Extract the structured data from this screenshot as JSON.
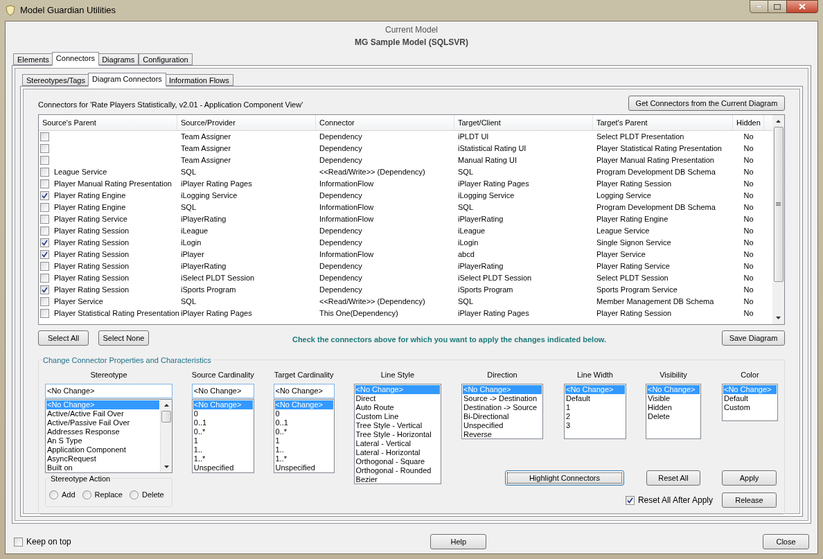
{
  "window": {
    "title": "Model Guardian Utilities"
  },
  "current_model": {
    "label": "Current Model",
    "name": "MG Sample Model (SQLSVR)"
  },
  "tabs": [
    {
      "label": "Elements",
      "selected": false
    },
    {
      "label": "Connectors",
      "selected": true
    },
    {
      "label": "Diagrams",
      "selected": false
    },
    {
      "label": "Configuration",
      "selected": false
    }
  ],
  "subtabs": [
    {
      "label": "Stereotypes/Tags",
      "selected": false
    },
    {
      "label": "Diagram Connectors",
      "selected": true
    },
    {
      "label": "Information Flows",
      "selected": false
    }
  ],
  "caption": "Connectors for 'Rate Players Statistically, v2.01 - Application Component View'",
  "get_button": "Get Connectors from the Current Diagram",
  "table": {
    "columns": [
      "Source's Parent",
      "Source/Provider",
      "Connector",
      "Target/Client",
      "Target's Parent",
      "Hidden"
    ],
    "rows": [
      {
        "checked": false,
        "source": "Team Assigner",
        "connector": "Dependency",
        "target": "iPLDT UI",
        "target_parent": "Select PLDT Presentation",
        "hidden": "No"
      },
      {
        "checked": false,
        "source": "Team Assigner",
        "connector": "Dependency",
        "target": "iStatistical Rating UI",
        "target_parent": "Player Statistical Rating Presentation",
        "hidden": "No"
      },
      {
        "checked": false,
        "source": "Team Assigner",
        "connector": "Dependency",
        "target": "Manual Rating UI",
        "target_parent": "Player Manual Rating Presentation",
        "hidden": "No"
      },
      {
        "checked": false,
        "source_parent": "League Service",
        "source": "SQL",
        "connector": "<<Read/Write>> (Dependency)",
        "target": "SQL",
        "target_parent": "Program Development DB Schema",
        "hidden": "No"
      },
      {
        "checked": false,
        "source_parent": "Player Manual Rating Presentation",
        "source": "iPlayer Rating Pages",
        "connector": "InformationFlow",
        "target": "iPlayer Rating Pages",
        "target_parent": "Player Rating Session",
        "hidden": "No"
      },
      {
        "checked": true,
        "source_parent": "Player Rating Engine",
        "source": "iLogging Service",
        "connector": "Dependency",
        "target": "iLogging Service",
        "target_parent": "Logging Service",
        "hidden": "No"
      },
      {
        "checked": false,
        "source_parent": "Player Rating Engine",
        "source": "SQL",
        "connector": "InformationFlow",
        "target": "SQL",
        "target_parent": "Program Development DB Schema",
        "hidden": "No"
      },
      {
        "checked": false,
        "source_parent": "Player Rating Service",
        "source": "iPlayerRating",
        "connector": "InformationFlow",
        "target": "iPlayerRating",
        "target_parent": "Player Rating Engine",
        "hidden": "No"
      },
      {
        "checked": false,
        "source_parent": "Player Rating Session",
        "source": "iLeague",
        "connector": "Dependency",
        "target": "iLeague",
        "target_parent": "League Service",
        "hidden": "No"
      },
      {
        "checked": true,
        "source_parent": "Player Rating Session",
        "source": "iLogin",
        "connector": "Dependency",
        "target": "iLogin",
        "target_parent": "Single Signon Service",
        "hidden": "No"
      },
      {
        "checked": true,
        "source_parent": "Player Rating Session",
        "source": "iPlayer",
        "connector": "InformationFlow",
        "target": "abcd",
        "target_parent": "Player Service",
        "hidden": "No"
      },
      {
        "checked": false,
        "source_parent": "Player Rating Session",
        "source": "iPlayerRating",
        "connector": "Dependency",
        "target": "iPlayerRating",
        "target_parent": "Player Rating Service",
        "hidden": "No"
      },
      {
        "checked": false,
        "source_parent": "Player Rating Session",
        "source": "iSelect PLDT Session",
        "connector": "Dependency",
        "target": "iSelect PLDT Session",
        "target_parent": "Select PLDT Session",
        "hidden": "No"
      },
      {
        "checked": true,
        "source_parent": "Player Rating Session",
        "source": "iSports Program",
        "connector": "Dependency",
        "target": "iSports Program",
        "target_parent": "Sports Program Service",
        "hidden": "No"
      },
      {
        "checked": false,
        "source_parent": "Player Service",
        "source": "SQL",
        "connector": "<<Read/Write>> (Dependency)",
        "target": "SQL",
        "target_parent": "Member Management DB Schema",
        "hidden": "No"
      },
      {
        "checked": false,
        "source_parent": "Player Statistical Rating Presentation",
        "source": "iPlayer Rating Pages",
        "connector": "This One(Dependency)",
        "target": "iPlayer Rating Pages",
        "target_parent": "Player Rating Session",
        "hidden": "No"
      }
    ]
  },
  "select_all": "Select All",
  "select_none": "Select None",
  "instruction": "Check the connectors above for which you want to apply the changes indicated below.",
  "save_button": "Save Diagram",
  "properties": {
    "title": "Change Connector Properties and Characteristics",
    "left_lists": [
      {
        "kind": "combo",
        "label": "Stereotype",
        "value": "<No Change>",
        "scrolls": true,
        "items": [
          {
            "text": "<No Change>",
            "selected": true
          },
          {
            "text": "Active/Active Fail Over",
            "selected": false
          },
          {
            "text": "Active/Passive Fail Over",
            "selected": false
          },
          {
            "text": "Addresses Response",
            "selected": false
          },
          {
            "text": "An S Type",
            "selected": false
          },
          {
            "text": "Application Component",
            "selected": false
          },
          {
            "text": "AsyncRequest",
            "selected": false
          },
          {
            "text": "Built on",
            "selected": false
          }
        ]
      },
      {
        "kind": "combo",
        "label": "Source Cardinality",
        "value": "<No Change>",
        "scrolls": false,
        "items": [
          {
            "text": "<No Change>",
            "selected": true
          },
          {
            "text": "0",
            "selected": false
          },
          {
            "text": "0..1",
            "selected": false
          },
          {
            "text": "0..*",
            "selected": false
          },
          {
            "text": "1",
            "selected": false
          },
          {
            "text": "1..",
            "selected": false
          },
          {
            "text": "1..*",
            "selected": false
          },
          {
            "text": "Unspecified",
            "selected": false
          }
        ]
      },
      {
        "kind": "combo",
        "label": "Target Cardinality",
        "value": "<No Change>",
        "scrolls": false,
        "items": [
          {
            "text": "<No Change>",
            "selected": true
          },
          {
            "text": "0",
            "selected": false
          },
          {
            "text": "0..1",
            "selected": false
          },
          {
            "text": "0..*",
            "selected": false
          },
          {
            "text": "1",
            "selected": false
          },
          {
            "text": "1..",
            "selected": false
          },
          {
            "text": "1..*",
            "selected": false
          },
          {
            "text": "Unspecified",
            "selected": false
          }
        ]
      },
      {
        "kind": "list",
        "label": "Line Style",
        "scrolls": false,
        "items": [
          {
            "text": "<No Change>",
            "selected": true
          },
          {
            "text": "Direct",
            "selected": false
          },
          {
            "text": "Auto Route",
            "selected": false
          },
          {
            "text": "Custom Line",
            "selected": false
          },
          {
            "text": "Tree Style - Vertical",
            "selected": false
          },
          {
            "text": "Tree Style - Horizontal",
            "selected": false
          },
          {
            "text": "Lateral - Vertical",
            "selected": false
          },
          {
            "text": "Lateral - Horizontal",
            "selected": false
          },
          {
            "text": "Orthogonal - Square",
            "selected": false
          },
          {
            "text": "Orthogonal - Rounded",
            "selected": false
          },
          {
            "text": "Bezier",
            "selected": false
          }
        ]
      }
    ],
    "right_lists": [
      {
        "kind": "list",
        "label": "Direction",
        "scrolls": false,
        "items": [
          {
            "text": "<No Change>",
            "selected": true
          },
          {
            "text": "Source -> Destination",
            "selected": false
          },
          {
            "text": "Destination -> Source",
            "selected": false
          },
          {
            "text": "Bi-Directional",
            "selected": false
          },
          {
            "text": "Unspecified",
            "selected": false
          },
          {
            "text": "Reverse",
            "selected": false
          }
        ]
      },
      {
        "kind": "list",
        "label": "Line Width",
        "scrolls": false,
        "items": [
          {
            "text": "<No Change>",
            "selected": true
          },
          {
            "text": "Default",
            "selected": false
          },
          {
            "text": "1",
            "selected": false
          },
          {
            "text": "2",
            "selected": false
          },
          {
            "text": "3",
            "selected": false
          }
        ]
      },
      {
        "kind": "list",
        "label": "Visibility",
        "scrolls": false,
        "items": [
          {
            "text": "<No Change>",
            "selected": true
          },
          {
            "text": "Visible",
            "selected": false
          },
          {
            "text": "Hidden",
            "selected": false
          },
          {
            "text": "Delete",
            "selected": false
          }
        ]
      },
      {
        "kind": "list",
        "label": "Color",
        "scrolls": false,
        "items": [
          {
            "text": "<No Change>",
            "selected": true
          },
          {
            "text": "Default",
            "selected": false
          },
          {
            "text": "Custom",
            "selected": false
          }
        ]
      }
    ],
    "stereotype_action": {
      "title": "Stereotype Action",
      "options": [
        {
          "label": "Add",
          "selected": false
        },
        {
          "label": "Replace",
          "selected": false
        },
        {
          "label": "Delete",
          "selected": false
        }
      ]
    },
    "highlight_button": "Highlight Connectors",
    "reset_button": "Reset All",
    "apply_button": "Apply",
    "release_button": "Release",
    "reset_after_apply": {
      "label": "Reset All After Apply",
      "checked": true
    }
  },
  "footer": {
    "keep_on_top": {
      "label": "Keep on top",
      "checked": false
    },
    "help_button": "Help",
    "close_button": "Close"
  }
}
